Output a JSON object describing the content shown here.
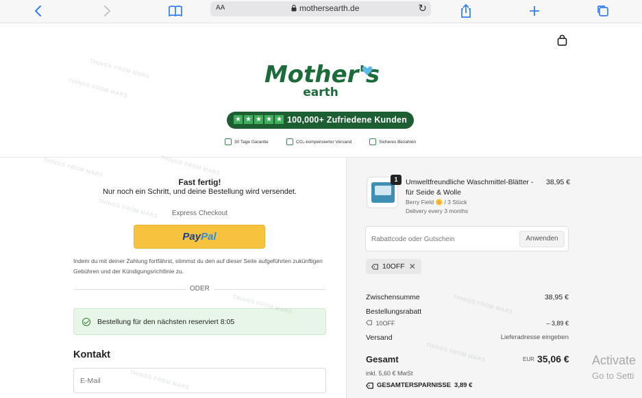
{
  "browser": {
    "text_size_label": "AA",
    "url": "mothersearth.de"
  },
  "header": {
    "logo_text": "Mother's earth",
    "rating_text": "100,000+ Zufriedene Kunden",
    "trust_items": [
      "30 Tage Garantie",
      "CO₂-kompensierter Versand",
      "Sicheres Bezahlen"
    ]
  },
  "checkout": {
    "title": "Fast fertig!",
    "subtitle": "Nur noch ein Schritt, und deine Bestellung wird versendet.",
    "express_label": "Express Checkout",
    "paypal_pay": "Pay",
    "paypal_pal": "Pal",
    "legal": "Indem du mit deiner Zahlung fortfährst, stimmst du den auf dieser Seite aufgeführten zukünftigen Gebühren und der Kündigungsrichtlinie zu.",
    "divider": "ODER",
    "reservation": "Bestellung für den nächsten reserviert 8:05",
    "contact_heading": "Kontakt",
    "email_placeholder": "E-Mail"
  },
  "summary": {
    "item": {
      "quantity": "1",
      "name": "Umweltfreundliche Waschmittel-Blätter - für Seide & Wolle",
      "variant": "Berry Field 🌼 / 3 Stück",
      "delivery": "Delivery every 3 months",
      "price": "38,95 €"
    },
    "discount_placeholder": "Rabattcode oder Gutschein",
    "apply_label": "Anwenden",
    "applied_code": "10OFF",
    "subtotal_label": "Zwischensumme",
    "subtotal_value": "38,95 €",
    "order_discount_label": "Bestellungsrabatt",
    "discount_code": "10OFF",
    "discount_value": "– 3,89 €",
    "shipping_label": "Versand",
    "shipping_value": "Lieferadresse eingeben",
    "total_label": "Gesamt",
    "currency": "EUR",
    "total_value": "35,06 €",
    "vat": "inkl. 5,60 € MwSt",
    "savings_label": "GESAMTERSPARNISSE",
    "savings_value": "3,89 €"
  },
  "watermark": "THINGS FROM MARS",
  "os_overlay": {
    "line1": "Activate",
    "line2": "Go to Setti"
  },
  "colors": {
    "brand_green": "#1c5e32",
    "paypal_yellow": "#f7c33f",
    "browser_blue": "#2f7ef6",
    "notice_green_bg": "#e7f6e6"
  }
}
